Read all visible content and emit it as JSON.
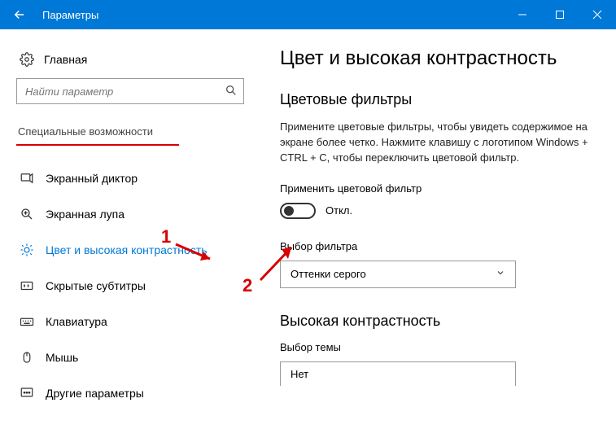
{
  "window": {
    "title": "Параметры"
  },
  "sidebar": {
    "home": "Главная",
    "search_placeholder": "Найти параметр",
    "category": "Специальные возможности",
    "items": [
      {
        "label": "Экранный диктор"
      },
      {
        "label": "Экранная лупа"
      },
      {
        "label": "Цвет и высокая контрастность"
      },
      {
        "label": "Скрытые субтитры"
      },
      {
        "label": "Клавиатура"
      },
      {
        "label": "Мышь"
      },
      {
        "label": "Другие параметры"
      }
    ]
  },
  "main": {
    "heading": "Цвет и высокая контрастность",
    "section1_title": "Цветовые фильтры",
    "section1_desc": "Примените цветовые фильтры, чтобы увидеть содержимое на экране более четко. Нажмите клавишу с логотипом Windows + CTRL + C, чтобы переключить цветовой фильтр.",
    "apply_filter_label": "Применить цветовой фильтр",
    "toggle_state": "Откл.",
    "filter_select_label": "Выбор фильтра",
    "filter_value": "Оттенки серого",
    "section2_title": "Высокая контрастность",
    "theme_select_label": "Выбор темы",
    "theme_value": "Нет"
  },
  "annotations": {
    "one": "1",
    "two": "2"
  }
}
